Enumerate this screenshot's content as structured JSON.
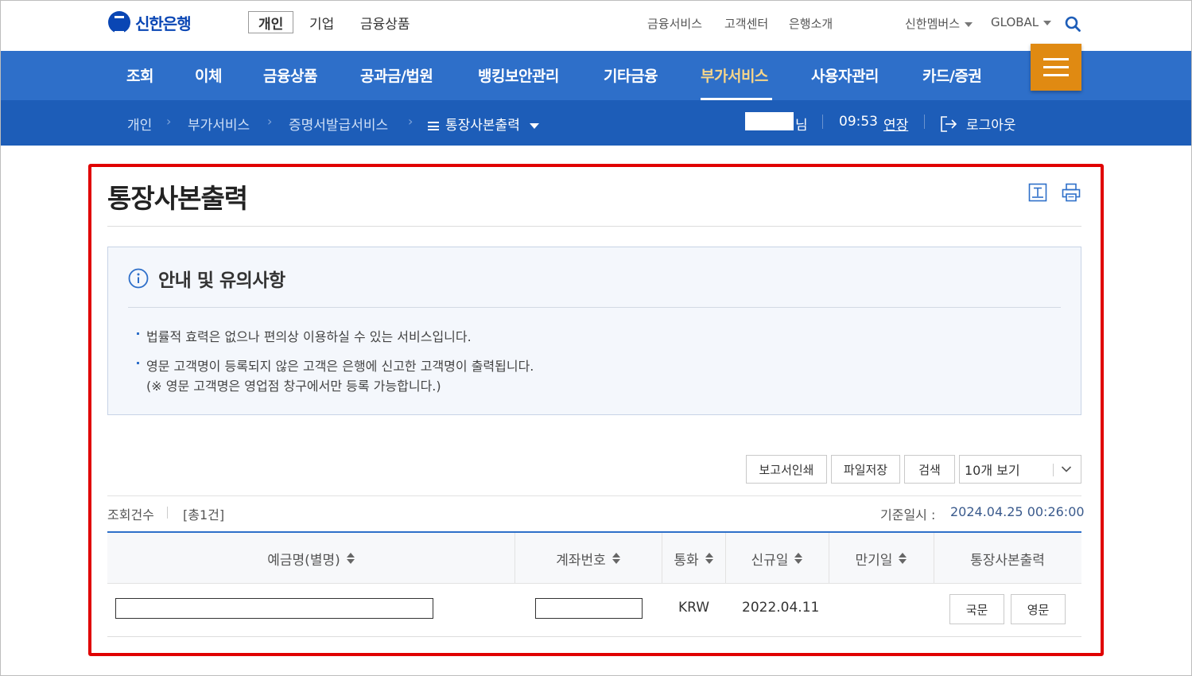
{
  "brand": {
    "logo_text": "신한은행",
    "accent": "#2e6fc9",
    "menu_button_color": "#e08a12"
  },
  "top": {
    "segments": [
      "개인",
      "기업",
      "금융상품"
    ],
    "links": [
      "금융서비스",
      "고객센터",
      "은행소개"
    ],
    "member": "신한멤버스",
    "global": "GLOBAL"
  },
  "gnb": {
    "items": [
      "조회",
      "이체",
      "금융상품",
      "공과금/법원",
      "뱅킹보안관리",
      "기타금융",
      "부가서비스",
      "사용자관리",
      "카드/증권"
    ],
    "active": "부가서비스"
  },
  "breadcrumb": {
    "items": [
      "개인",
      "부가서비스",
      "증명서발급서비스"
    ],
    "current": "통장사본출력"
  },
  "session": {
    "user_suffix": "님",
    "timer": "09:53",
    "extend": "연장",
    "logout": "로그아웃"
  },
  "page": {
    "title": "통장사본출력"
  },
  "notice": {
    "title": "안내 및 유의사항",
    "items": [
      "법률적 효력은 없으나 편의상 이용하실 수 있는 서비스입니다.",
      "영문 고객명이 등록되지 않은 고객은 은행에 신고한 고객명이 출력됩니다."
    ],
    "sub": "(※ 영문 고객명은 영업점 창구에서만 등록 가능합니다.)"
  },
  "toolbar": {
    "print_report": "보고서인쇄",
    "save_file": "파일저장",
    "search": "검색",
    "page_size": "10개 보기"
  },
  "summary": {
    "count_label": "조회건수",
    "count_value": "[총1건]",
    "base_label": "기준일시 :",
    "base_value": "2024.04.25 00:26:00"
  },
  "table": {
    "headers": [
      "예금명(별명)",
      "계좌번호",
      "통화",
      "신규일",
      "만기일",
      "통장사본출력"
    ],
    "rows": [
      {
        "currency": "KRW",
        "open_date": "2022.04.11",
        "due_date": "",
        "btn_kr": "국문",
        "btn_en": "영문"
      }
    ]
  }
}
